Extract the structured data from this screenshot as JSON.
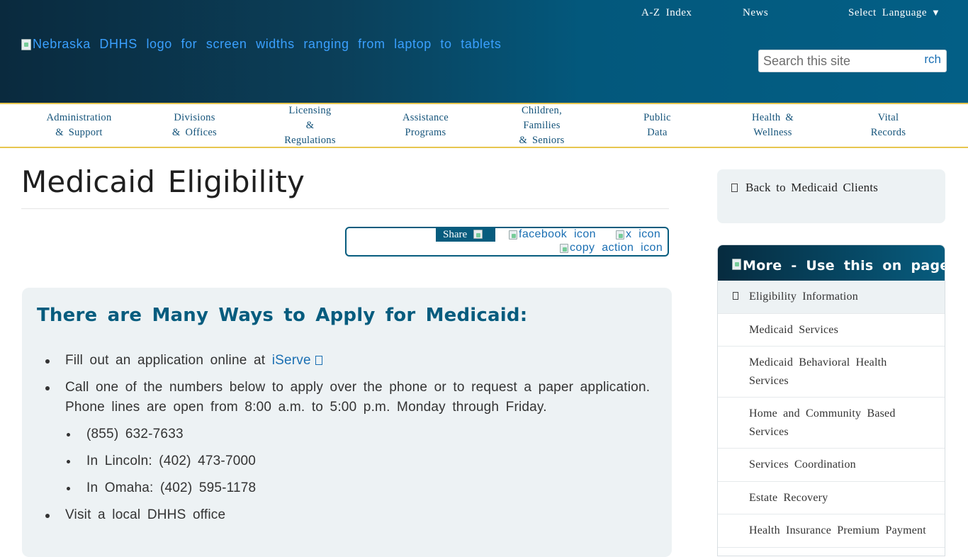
{
  "header": {
    "links": [
      "A-Z Index",
      "News"
    ],
    "language_label": "Select Language",
    "language_arrow": "▼",
    "logo_alt": "Nebraska DHHS logo for screen widths ranging from laptop to tablets",
    "search_placeholder": "Search this site",
    "search_button": "rch"
  },
  "nav": [
    "Administration\n& Support",
    "Divisions\n& Offices",
    "Licensing\n&\nRegulations",
    "Assistance\nPrograms",
    "Children,\nFamilies\n& Seniors",
    "Public\nData",
    "Health &\nWellness",
    "Vital\nRecords"
  ],
  "main": {
    "title": "Medicaid Eligibility",
    "share": {
      "label": "Share",
      "facebook_alt": "facebook icon",
      "x_alt": "x icon",
      "copy_alt": "copy action icon"
    },
    "callout": {
      "heading": "There are Many Ways to Apply for Medicaid:",
      "item1_prefix": "Fill out an application online at",
      "item1_link": "iServe",
      "item2": "Call one of the numbers below to apply over the phone or to request a paper application. Phone lines are open from 8:00 a.m. to 5:00 p.m. Monday through Friday.",
      "phones": [
        "(855) 632-7633",
        "In Lincoln: (402) 473-7000",
        "In Omaha: (402) 595-1178"
      ],
      "item3": "Visit a local DHHS office"
    }
  },
  "sidebar": {
    "back_label": "Back to Medicaid Clients",
    "more_heading": "More - Use this on pages as",
    "items": [
      "Eligibility Information",
      "Medicaid Services",
      "Medicaid Behavioral Health Services",
      "Home and Community Based Services",
      "Services Coordination",
      "Estate Recovery",
      "Health Insurance Premium Payment"
    ]
  }
}
